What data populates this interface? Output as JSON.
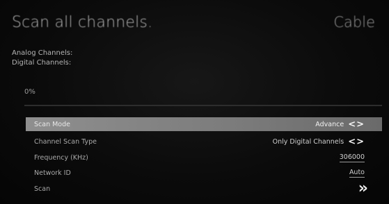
{
  "header": {
    "title": "Scan all channels.",
    "source": "Cable"
  },
  "info": {
    "analog_label": "Analog Channels:",
    "digital_label": "Digital Channels:"
  },
  "progress": {
    "percent_text": "0%",
    "value": 0
  },
  "settings": [
    {
      "label": "Scan Mode",
      "value": "Advance",
      "icon": "left-right-arrows-icon",
      "selected": true
    },
    {
      "label": "Channel Scan Type",
      "value": "Only Digital Channels",
      "icon": "left-right-arrows-icon",
      "selected": false
    },
    {
      "label": "Frequency (KHz)",
      "value": "306000",
      "icon": "",
      "selected": false
    },
    {
      "label": "Network ID",
      "value": "Auto",
      "icon": "",
      "selected": false
    },
    {
      "label": "Scan",
      "value": "",
      "icon": "double-chevron-right-icon",
      "selected": false
    }
  ],
  "icons": {
    "left_right_arrows": "<>",
    "double_chevron": "»"
  },
  "colors": {
    "highlight": "#8f8f8f",
    "background": "#0b0b0b"
  }
}
